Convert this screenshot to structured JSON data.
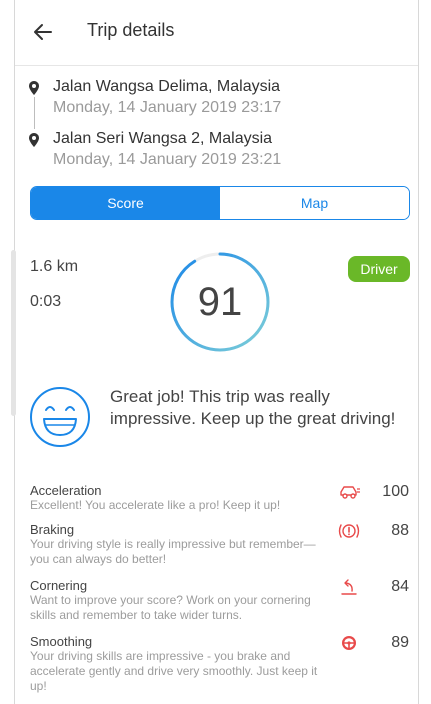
{
  "header": {
    "title": "Trip details",
    "back_icon": "arrow-left-icon"
  },
  "trip": {
    "start": {
      "name": "Jalan Wangsa Delima, Malaysia",
      "datetime": "Monday, 14 January 2019 23:17"
    },
    "end": {
      "name": "Jalan Seri Wangsa 2, Malaysia",
      "datetime": "Monday, 14 January 2019 23:21"
    }
  },
  "tabs": {
    "score": "Score",
    "map": "Map",
    "active": "Score"
  },
  "stats": {
    "distance": "1.6 km",
    "duration": "0:03",
    "score": "91",
    "role_badge": "Driver"
  },
  "colors": {
    "accent": "#1a87e8",
    "badge": "#6ab828",
    "icon_red": "#e84a4a",
    "ring_start": "#7fd0d8",
    "ring_end": "#1a87e8"
  },
  "message": {
    "text": "Great job! This trip was really impressive. Keep up the great driving!",
    "icon": "smiley-face-icon"
  },
  "metrics": [
    {
      "title": "Acceleration",
      "description": "Excellent! You accelerate like a pro! Keep it up!",
      "score": "100",
      "icon": "car-acceleration-icon"
    },
    {
      "title": "Braking",
      "description": "Your driving style is really impressive but remember—you can always do better!",
      "score": "88",
      "icon": "brake-warning-icon"
    },
    {
      "title": "Cornering",
      "description": "Want to improve your score? Work on your cornering skills and remember to take wider turns.",
      "score": "84",
      "icon": "turn-arrow-icon"
    },
    {
      "title": "Smoothing",
      "description": "Your driving skills are impressive - you brake and accelerate gently and drive very smoothly. Just keep it up!",
      "score": "89",
      "icon": "steering-wheel-icon"
    }
  ]
}
